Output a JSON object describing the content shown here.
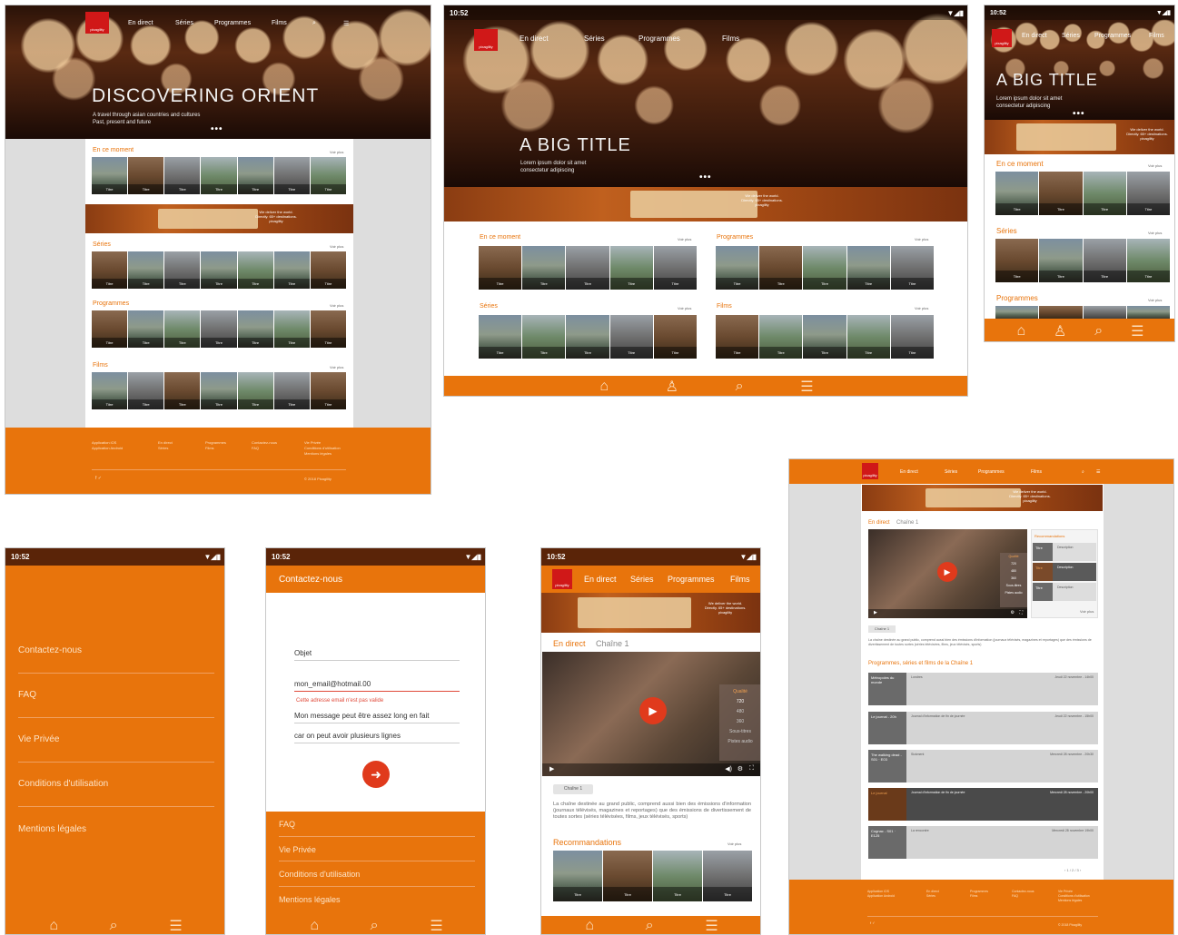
{
  "status_time": "10:52",
  "status_icons": "▼◢▮",
  "brand": "pixagility",
  "nav": {
    "live": "En direct",
    "series": "Séries",
    "programs": "Programmes",
    "films": "Films"
  },
  "hero": {
    "title_main": "DISCOVERING ORIENT",
    "sub_main_1": "A travel through asian countries and cultures",
    "sub_main_2": "Past, present and future",
    "title_big": "A BIG TITLE",
    "sub_big_1": "Lorem ipsum dolor sit amet",
    "sub_big_2": "consectetur adipiscing",
    "dots": "•••"
  },
  "banner": {
    "line1": "We deliver the world.",
    "line2": "Directly. 65+ destinations.",
    "brand": "pixagility"
  },
  "sections": {
    "now": "En ce moment",
    "series": "Séries",
    "programs": "Programmes",
    "films": "Films",
    "see_more": "Voir plus",
    "recommendations": "Recommandations"
  },
  "thumb_label": "Titre",
  "desktop_footer": {
    "col1": [
      "Application iOS",
      "Application Android"
    ],
    "col2": [
      "En direct",
      "Séries"
    ],
    "col3": [
      "Programmes",
      "Films"
    ],
    "col4": [
      "Contactez-nous",
      "FAQ"
    ],
    "col5": [
      "Vie Privée",
      "Conditions d'utilisation",
      "Mentions légales"
    ],
    "social": "f ✓",
    "copyright": "© 2018 Pixagility"
  },
  "menu": {
    "items": [
      "Contactez-nous",
      "FAQ",
      "Vie Privée",
      "Conditions d'utilisation",
      "Mentions légales"
    ]
  },
  "contact": {
    "title": "Contactez-nous",
    "subject": "Objet",
    "email": "mon_email@hotmail.00",
    "error": "Cette adresse email n'est pas valide",
    "message_1": "Mon message peut être assez long en fait",
    "message_2": "car on peut avoir plusieurs lignes",
    "footer_items": [
      "FAQ",
      "Vie Privée",
      "Conditions d'utilisation",
      "Mentions légales"
    ]
  },
  "player": {
    "live": "En direct",
    "channel": "Chaîne 1",
    "quality_label": "Qualité",
    "qualities": [
      "720",
      "480",
      "360"
    ],
    "subtitles": "Sous-titres",
    "audio": "Pistes audio",
    "channel_chip": "Chaîne 1",
    "description": "La chaîne destinée au grand public, comprend aussi bien des émissions d'information (journaux télévisés, magazines et reportages) que des émissions de divertissement de toutes sortes (séries télévisées, films, jeux télévisés, sports)"
  },
  "desktop_player": {
    "rec_title": "Recommandations",
    "rec_items": [
      {
        "t": "Titre",
        "d": "Description"
      },
      {
        "t": "Titre",
        "d": "Description"
      },
      {
        "t": "Titre",
        "d": "Description"
      }
    ],
    "list_title": "Programmes, séries et films de la Chaîne 1",
    "list": [
      {
        "thumb": "Métropoles du monde",
        "title": "Londres",
        "date": "Jeudi 22 novembre - 14h00"
      },
      {
        "thumb": "Le journal - 20h",
        "title": "Journal d'information de fin de journée",
        "date": "Jeudi 22 novembre - 15h00"
      },
      {
        "thumb": "The walking dead - S01 · E03",
        "title": "Sickment",
        "date": "Mercredi 28 novembre - 20h30"
      },
      {
        "thumb": "Le journal",
        "title": "Journal d'information de fin de journée",
        "date": "Mercredi 28 novembre - 20h00"
      },
      {
        "thumb": "Cognac - S01 · E125",
        "title": "La rencontre",
        "date": "Mercredi 28 novembre 19h00"
      }
    ],
    "pager": "‹ 1 / 2 / 3 ›"
  }
}
